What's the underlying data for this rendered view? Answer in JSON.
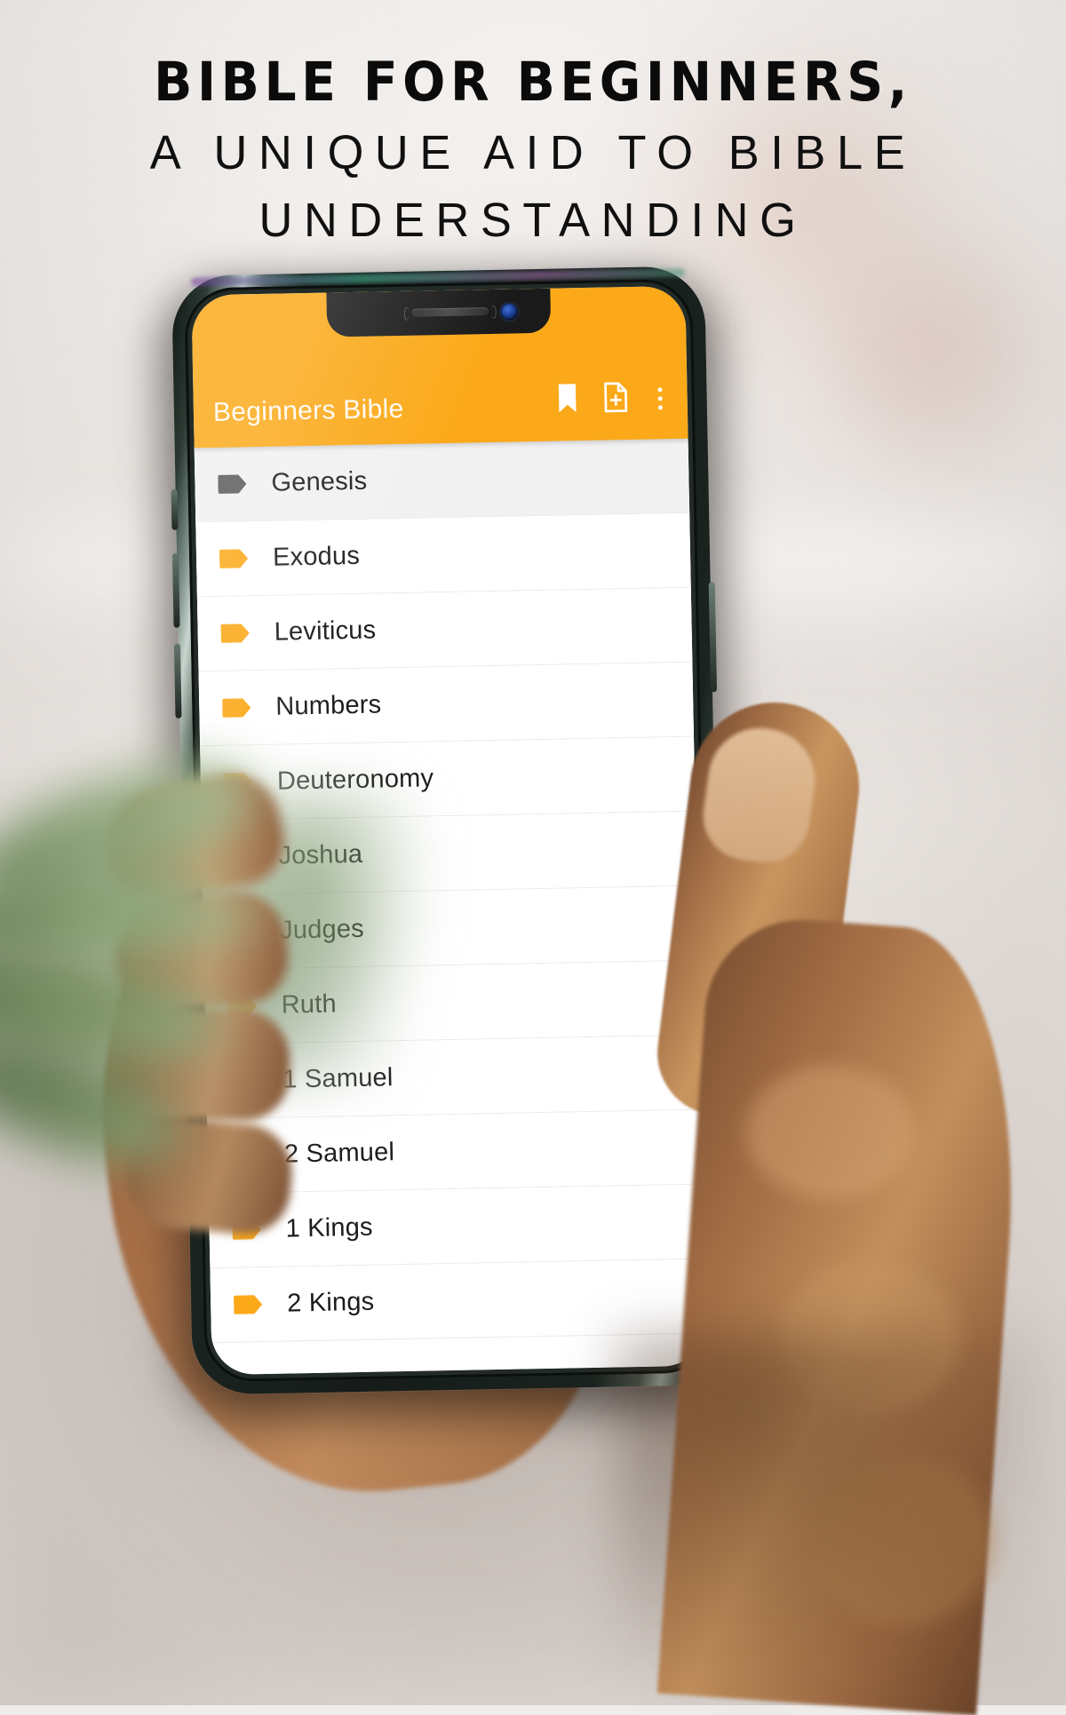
{
  "headline": {
    "line1": "BIBLE FOR BEGINNERS,",
    "line2": "A UNIQUE AID TO BIBLE",
    "line3": "UNDERSTANDING"
  },
  "colors": {
    "accent_orange": "#FBA919",
    "headline_text": "#0b0b0b",
    "appbar_title": "#fffaf2",
    "selected_tag": "#5a5a5a",
    "row_text": "#1c1c1c",
    "background": "#efecea"
  },
  "phone": {
    "status": {
      "notch": true
    },
    "app": {
      "appbar": {
        "title": "Beginners Bible",
        "actions": [
          {
            "name": "bookmark-icon",
            "label": "Bookmark"
          },
          {
            "name": "add-note-icon",
            "label": "Add note"
          },
          {
            "name": "overflow-menu-icon",
            "label": "More options"
          }
        ]
      },
      "book_list": [
        {
          "label": "Genesis",
          "tag_color": "#5a5a5a",
          "selected": true
        },
        {
          "label": "Exodus",
          "tag_color": "#FBA919",
          "selected": false
        },
        {
          "label": "Leviticus",
          "tag_color": "#FBA919",
          "selected": false
        },
        {
          "label": "Numbers",
          "tag_color": "#FBA919",
          "selected": false
        },
        {
          "label": "Deuteronomy",
          "tag_color": "#FBA919",
          "selected": false
        },
        {
          "label": "Joshua",
          "tag_color": "#FBA919",
          "selected": false
        },
        {
          "label": "Judges",
          "tag_color": "#FBA919",
          "selected": false
        },
        {
          "label": "Ruth",
          "tag_color": "#FBA919",
          "selected": false
        },
        {
          "label": "1 Samuel",
          "tag_color": "#FBA919",
          "selected": false
        },
        {
          "label": "2 Samuel",
          "tag_color": "#FBA919",
          "selected": false
        },
        {
          "label": "1 Kings",
          "tag_color": "#FBA919",
          "selected": false
        },
        {
          "label": "2 Kings",
          "tag_color": "#FBA919",
          "selected": false
        }
      ]
    }
  }
}
